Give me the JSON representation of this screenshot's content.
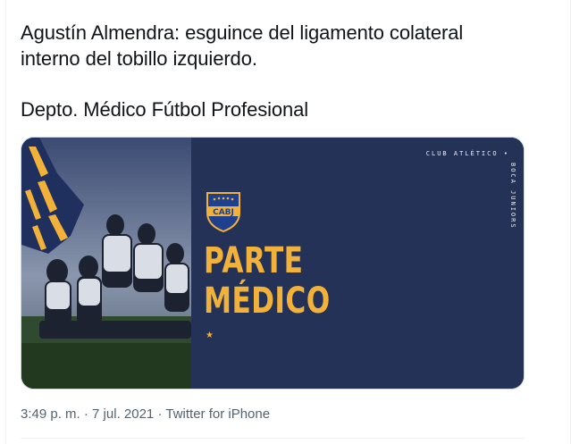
{
  "tweet": {
    "lines": [
      "Agustín Almendra: esguince del ligamento colateral",
      "interno del tobillo izquierdo.",
      "Depto. Médico Fútbol Profesional"
    ]
  },
  "card": {
    "club_horizontal": "CLUB ATLÉTICO •",
    "club_vertical": "BOCA JUNIORS",
    "crest_text": "CABJ",
    "headline_1": "PARTE",
    "headline_2": "MÉDICO",
    "star": "★",
    "colors": {
      "panel": "#243258",
      "accent": "#f2b23a"
    }
  },
  "meta": {
    "time": "3:49 p. m.",
    "separator_1": "·",
    "date": "7 jul. 2021",
    "separator_2": "·",
    "source": "Twitter for iPhone"
  }
}
